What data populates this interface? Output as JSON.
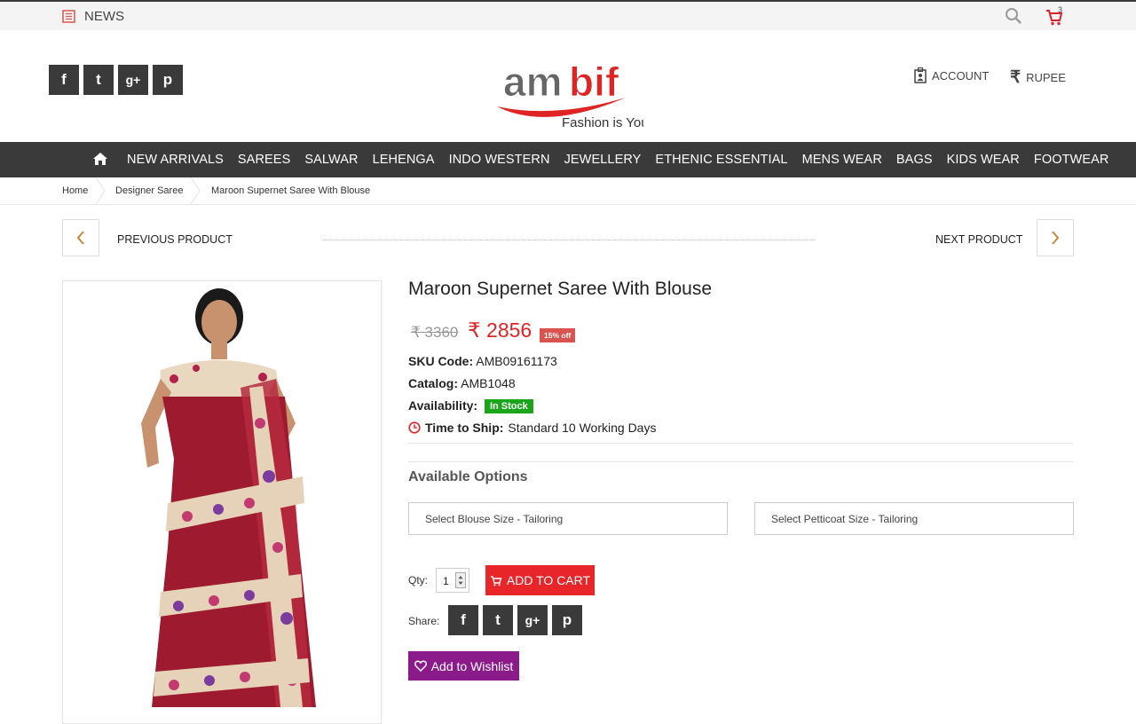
{
  "topbar": {
    "news_label": "NEWS",
    "cart_count": "3"
  },
  "header": {
    "logo_text": "ambif",
    "logo_tagline": "Fashion is You",
    "account_label": "ACCOUNT",
    "currency_label": "RUPEE",
    "social": [
      "f",
      "t",
      "g+",
      "p"
    ]
  },
  "nav": {
    "items": [
      "NEW ARRIVALS",
      "SAREES",
      "SALWAR",
      "LEHENGA",
      "INDO WESTERN",
      "JEWELLERY",
      "ETHENIC ESSENTIAL",
      "MENS WEAR",
      "BAGS",
      "KIDS WEAR",
      "FOOTWEAR"
    ]
  },
  "breadcrumb": [
    "Home",
    "Designer Saree",
    "Maroon Supernet Saree With Blouse"
  ],
  "pager": {
    "previous_label": "PREVIOUS PRODUCT",
    "next_label": "NEXT PRODUCT"
  },
  "product": {
    "title": "Maroon Supernet Saree With Blouse",
    "old_price": "₹ 3360",
    "new_price": "₹ 2856",
    "discount": "15% off",
    "sku_label": "SKU Code:",
    "sku": "AMB09161173",
    "catalog_label": "Catalog:",
    "catalog": "AMB1048",
    "availability_label": "Availability:",
    "availability": "In Stock",
    "ship_label": "Time to Ship:",
    "ship": "Standard 10 Working Days"
  },
  "options": {
    "heading": "Available Options",
    "blouse_placeholder": "Select Blouse Size - Tailoring",
    "petticoat_placeholder": "Select Petticoat Size - Tailoring"
  },
  "purchase": {
    "qty_label": "Qty:",
    "qty_value": "1",
    "add_to_cart": "ADD TO CART",
    "share_label": "Share:",
    "wishlist": "Add to Wishlist"
  },
  "colors": {
    "accent_red": "#e8262a",
    "nav_bg": "#3a3a3a",
    "wishlist_purple": "#8b1a8b",
    "stock_green": "#1aa51a"
  }
}
